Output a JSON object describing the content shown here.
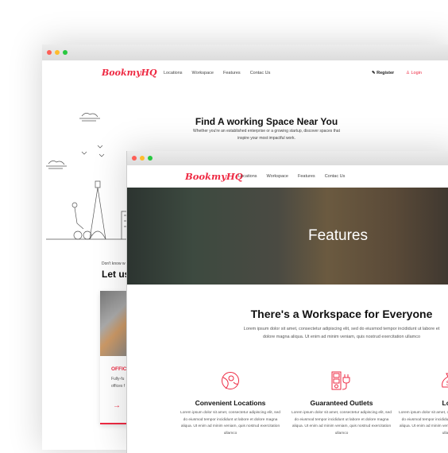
{
  "back": {
    "logo": "BookmyHQ",
    "nav": [
      "Locations",
      "Workspace",
      "Features",
      "Contac Us"
    ],
    "register": "Register",
    "login": "Login",
    "hero_title": "Find A working Space Near You",
    "hero_sub": "Whether you're an established enterprise or a growing startup, discover spaces that inspire your most impactful work.",
    "section_kicker": "Don't know w",
    "section_title": "Let us",
    "card_title": "OFFIC",
    "card_text": "Fully-fu offices f",
    "card_arrow": "→"
  },
  "front": {
    "logo": "BookmyHQ",
    "nav": [
      "Locations",
      "Workspace",
      "Features",
      "Contac Us"
    ],
    "hero_title": "Features",
    "section_title": "There's a Workspace for Everyone",
    "section_text": "Lorem ipsum dolor sit amet, consectetur adipiscing elit, sed do eiusmod tempor incididunt ut labore et dolore magna aliqua. Ut enim ad minim veniam, quis nostrud exercitation ullamco",
    "features": [
      {
        "icon": "globe-location-icon",
        "title": "Convenient Locations",
        "text": "Lorem ipsum dolor sit amet, consectetur adipiscing elit, sed do eiusmod tempor incididunt ut labore et dolore magna aliqua. Ut enim ad minim veniam, quis nostrud exercitation ullamco"
      },
      {
        "icon": "power-outlet-icon",
        "title": "Guaranteed Outlets",
        "text": "Lorem ipsum dolor sit amet, consectetur adipiscing elit, sed do eiusmod tempor incididunt ut labore et dolore magna aliqua. Ut enim ad minim veniam, quis nostrud exercitation ullamco"
      },
      {
        "icon": "money-bag-icon",
        "title": "Low",
        "text": "Lorem ipsum dolor sit amet, consectetur adipiscing elit, sed do eiusmod tempor incididunt ut labore et dolore magna aliqua. Ut enim ad minim veniam, quis nostrud exercitation ullamco"
      }
    ]
  },
  "colors": {
    "accent": "#ee2a43"
  }
}
